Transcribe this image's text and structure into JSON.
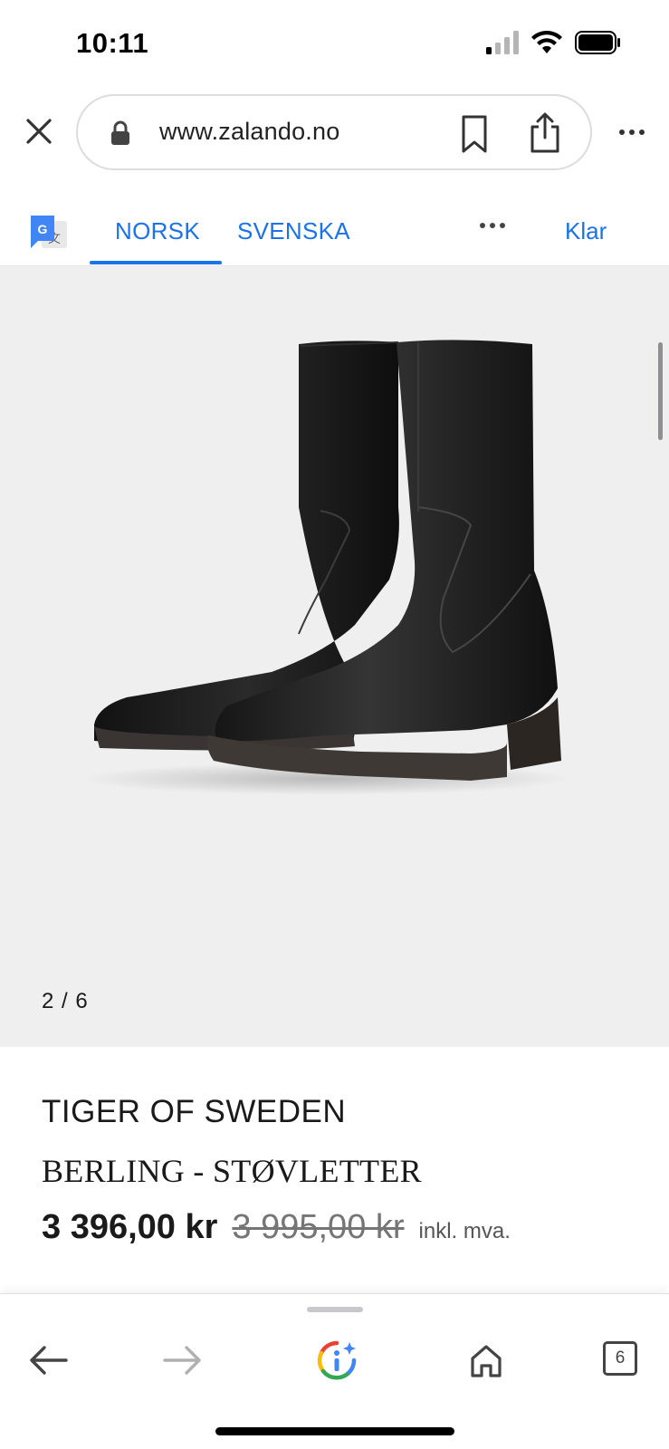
{
  "status_bar": {
    "time": "10:11",
    "icons": [
      "cellular-signal-icon",
      "wifi-icon",
      "battery-icon"
    ]
  },
  "browser": {
    "url": "www.zalando.no",
    "icons": [
      "close-icon",
      "lock-icon",
      "bookmark-icon",
      "share-icon",
      "more-icon"
    ]
  },
  "translate_bar": {
    "tabs": [
      {
        "label": "NORSK",
        "active": true
      },
      {
        "label": "SVENSKA",
        "active": false
      }
    ],
    "done_label": "Klar",
    "accent_color": "#1a73e8"
  },
  "gallery": {
    "counter": "2 / 6",
    "current": 2,
    "total": 6,
    "image_subject": "black leather ankle boots"
  },
  "product": {
    "brand": "TIGER OF SWEDEN",
    "name": "BERLING - STØVLETTER",
    "price_now": "3 396,00 kr",
    "price_was": "3 995,00 kr",
    "vat_note": "inkl. mva."
  },
  "toolbar": {
    "tab_count": "6",
    "icons": [
      "back-arrow-icon",
      "forward-arrow-icon",
      "google-lens-icon",
      "home-icon",
      "tabs-icon"
    ]
  }
}
